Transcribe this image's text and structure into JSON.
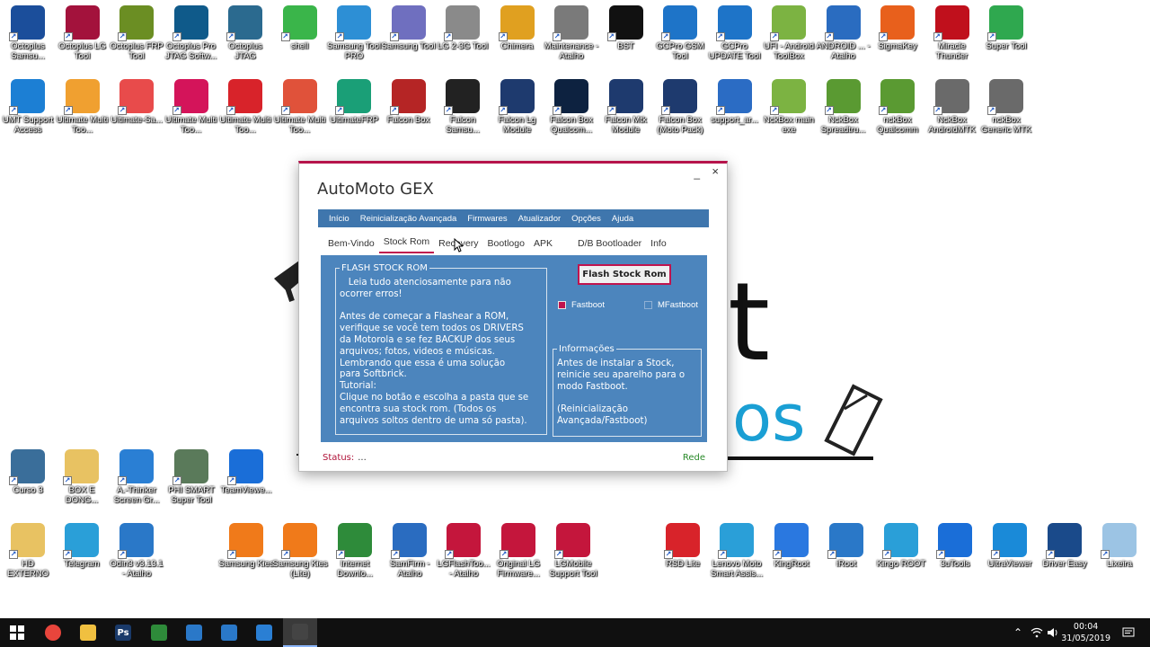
{
  "desktop": {
    "row1": [
      {
        "label": "Octoplus Samsu...",
        "icon": "octoplus-icon",
        "color": "#1b4e9b"
      },
      {
        "label": "Octoplus LG Tool",
        "icon": "octoplus-lg-icon",
        "color": "#a3123c"
      },
      {
        "label": "Octoplus FRP Tool",
        "icon": "octoplus-frp-icon",
        "color": "#6b8e23"
      },
      {
        "label": "Octoplus Pro JTAG Softw...",
        "icon": "octoplus-pro-icon",
        "color": "#0f5a8a"
      },
      {
        "label": "Octoplus JTAG",
        "icon": "octoplus-jtag-icon",
        "color": "#2b6a8f"
      },
      {
        "label": "shell",
        "icon": "shell-icon",
        "color": "#3ab54a"
      },
      {
        "label": "Samsung Tool PRO",
        "icon": "samsung-tool-pro-icon",
        "color": "#2d8fd5"
      },
      {
        "label": "Samsung Tool",
        "icon": "samsung-tool-icon",
        "color": "#6f6fbf"
      },
      {
        "label": "LG 2-3G Tool",
        "icon": "lg-tool-icon",
        "color": "#8a8a8a"
      },
      {
        "label": "Chimera",
        "icon": "chimera-icon",
        "color": "#e0a020"
      },
      {
        "label": "Maintenance - Atalho",
        "icon": "maintenance-icon",
        "color": "#7a7a7a"
      },
      {
        "label": "BST",
        "icon": "bst-icon",
        "color": "#111111"
      },
      {
        "label": "GCPro GSM Tool",
        "icon": "gcpro-gsm-icon",
        "color": "#1e74c8"
      },
      {
        "label": "GCPro UPDATE Tool",
        "icon": "gcpro-update-icon",
        "color": "#1e74c8"
      },
      {
        "label": "UFI - Android ToolBox",
        "icon": "ufi-android-icon",
        "color": "#7cb342"
      },
      {
        "label": "ANDROID ... - Atalho",
        "icon": "android-atalho-icon",
        "color": "#2a6cc0"
      },
      {
        "label": "SigmaKey",
        "icon": "sigmakey-icon",
        "color": "#e8601c"
      },
      {
        "label": "Miracle Thunder",
        "icon": "miracle-thunder-icon",
        "color": "#c0101c"
      },
      {
        "label": "Super Tool",
        "icon": "super-tool-icon",
        "color": "#2fa84f"
      }
    ],
    "row2": [
      {
        "label": "UMT Support Access",
        "icon": "umt-icon",
        "color": "#1c7fd4"
      },
      {
        "label": "Ultimate Multi Too...",
        "icon": "ultimate-multi-icon",
        "color": "#f0a030"
      },
      {
        "label": "Ultimate-Sa...",
        "icon": "ultimate-sa-icon",
        "color": "#e84b4b"
      },
      {
        "label": "Ultimate Multi Too...",
        "icon": "ultimate-multi-lg-icon",
        "color": "#d4145a"
      },
      {
        "label": "Ultimate Multi Too...",
        "icon": "ultimate-multi-sd-icon",
        "color": "#d8232a"
      },
      {
        "label": "Ultimate Multi Too...",
        "icon": "ultimate-multi-phone-icon",
        "color": "#e0523a"
      },
      {
        "label": "UltimateFRP",
        "icon": "ultimate-frp-icon",
        "color": "#1a9f77"
      },
      {
        "label": "Falcon Box",
        "icon": "falcon-box-icon",
        "color": "#b52525"
      },
      {
        "label": "Falcon Samsu...",
        "icon": "falcon-samsung-icon",
        "color": "#222222"
      },
      {
        "label": "Falcon Lg Module",
        "icon": "falcon-lg-icon",
        "color": "#1e3a6e"
      },
      {
        "label": "Falcon Box Qualcom...",
        "icon": "falcon-qualcomm-icon",
        "color": "#0d2240"
      },
      {
        "label": "Falcon Mtk Module",
        "icon": "falcon-mtk-icon",
        "color": "#1e3a6e"
      },
      {
        "label": "Falcon Box (Moto Pack)",
        "icon": "falcon-moto-icon",
        "color": "#1e3a6e"
      },
      {
        "label": "support_ar...",
        "icon": "support-icon",
        "color": "#2b6cc4"
      },
      {
        "label": "NckBox main exe",
        "icon": "nckbox-main-icon",
        "color": "#7cb342"
      },
      {
        "label": "NckBox Spreadtru...",
        "icon": "nckbox-spreadtrum-icon",
        "color": "#5a9a32"
      },
      {
        "label": "nckBox Qualcomm",
        "icon": "nckbox-qualcomm-icon",
        "color": "#5a9a32"
      },
      {
        "label": "NckBox AndroidMTK",
        "icon": "nckbox-androidmtk-icon",
        "color": "#6a6a6a"
      },
      {
        "label": "nckBox Generic MTK",
        "icon": "nckbox-generic-icon",
        "color": "#6a6a6a"
      }
    ],
    "row3": [
      {
        "label": "Curso 3",
        "icon": "curso-icon",
        "color": "#3a6e9a"
      },
      {
        "label": "BOX E DONG...",
        "icon": "folder-icon",
        "color": "#e8c262"
      },
      {
        "label": "A.-Thinker Screen Gr...",
        "icon": "screen-grabber-icon",
        "color": "#2a7fd4"
      },
      {
        "label": "PHI SMART Super Tool",
        "icon": "phi-smart-icon",
        "color": "#5a7a5a"
      },
      {
        "label": "TeamViewe...",
        "icon": "teamviewer-icon",
        "color": "#1a6ed8"
      }
    ],
    "row4": [
      {
        "label": "HD EXTERNO",
        "icon": "folder-icon",
        "color": "#e8c262"
      },
      {
        "label": "Telegram",
        "icon": "telegram-icon",
        "color": "#2a9fd8"
      },
      {
        "label": "Odin3 v3.13.1 - Atalho",
        "icon": "odin-icon",
        "color": "#2a78c8"
      },
      {
        "label": "Samsung Kies",
        "icon": "samsung-kies-icon",
        "color": "#f07a1a"
      },
      {
        "label": "Samsung Kies (Lite)",
        "icon": "samsung-kies-lite-icon",
        "color": "#f07a1a"
      },
      {
        "label": "Internet Downlo...",
        "icon": "idm-icon",
        "color": "#2e8b3a"
      },
      {
        "label": "SamFirm - Atalho",
        "icon": "samfirm-icon",
        "color": "#2a6cc0"
      },
      {
        "label": "LGFlashToo... - Atalho",
        "icon": "lg-flash-icon",
        "color": "#c4163c"
      },
      {
        "label": "Original LG Firmware...",
        "icon": "lg-firmware-icon",
        "color": "#c4163c"
      },
      {
        "label": "LGMobile Support Tool",
        "icon": "lg-mobile-icon",
        "color": "#c4163c"
      },
      {
        "label": "RSD Lite",
        "icon": "rsd-lite-icon",
        "color": "#d8232a"
      },
      {
        "label": "Lenovo Moto Smart Assis...",
        "icon": "lenovo-moto-icon",
        "color": "#2a9fd8"
      },
      {
        "label": "KingRoot",
        "icon": "kingroot-icon",
        "color": "#2a78e0"
      },
      {
        "label": "iRoot",
        "icon": "iroot-icon",
        "color": "#2a78c8"
      },
      {
        "label": "Kingo ROOT",
        "icon": "kingo-root-icon",
        "color": "#2a9fd8"
      },
      {
        "label": "3uTools",
        "icon": "3utools-icon",
        "color": "#1a6ed8"
      },
      {
        "label": "UltraViewer",
        "icon": "ultraviewer-icon",
        "color": "#1a8ad8"
      },
      {
        "label": "Driver Easy",
        "icon": "driver-easy-icon",
        "color": "#1a4a8a"
      },
      {
        "label": "Lixeira",
        "icon": "recycle-bin-icon",
        "color": "#9cc4e4"
      }
    ]
  },
  "window": {
    "title": "AutoMoto GEX",
    "minimize_glyph": "_",
    "close_glyph": "×",
    "menu": [
      "Início",
      "Reinicialização Avançada",
      "Firmwares",
      "Atualizador",
      "Opções",
      "Ajuda"
    ],
    "tabs": [
      "Bem-Vindo",
      "Stock Rom",
      "Recovery",
      "Bootlogo",
      "APK",
      "D/B Bootloader",
      "Info"
    ],
    "active_tab": "Stock Rom",
    "flash_group": {
      "legend": "FLASH STOCK ROM",
      "text": "   Leia tudo atenciosamente para não\nocorrer erros!\n\nAntes de começar a Flashear a ROM,\nverifique se você tem todos os DRIVERS\nda Motorola e se fez BACKUP dos seus\narquivos; fotos, videos e músicas.\nLembrando que essa é uma solução\npara Softbrick.\nTutorial:\nClique no botão e escolha a pasta que se\nencontra sua stock rom. (Todos os\narquivos soltos dentro de uma só pasta)."
    },
    "flash_button": "Flash Stock Rom",
    "checkbox_fastboot": "Fastboot",
    "checkbox_mfastboot": "MFastboot",
    "info_group": {
      "legend": "Informações",
      "text": "Antes de instalar a Stock,\nreinicie seu aparelho para o\nmodo Fastboot.\n\n(Reinicialização\nAvançada/Fastboot)"
    },
    "status_label": "Status:",
    "status_value": "...",
    "network_label": "Rede"
  },
  "taskbar": {
    "clock_time": "00:04",
    "clock_date": "31/05/2019",
    "apps": [
      {
        "name": "windows-start-icon"
      },
      {
        "name": "chrome-icon",
        "color": "#e8453c"
      },
      {
        "name": "file-explorer-icon",
        "color": "#f0c040"
      },
      {
        "name": "photoshop-icon",
        "color": "#1a3a6a",
        "text": "Ps"
      },
      {
        "name": "xbox-icon",
        "color": "#2e8b3a"
      },
      {
        "name": "vpn-shield-icon",
        "color": "#2a78c8"
      },
      {
        "name": "tool-icon",
        "color": "#2a78c8"
      },
      {
        "name": "screen-grabber-icon",
        "color": "#2a7fd4"
      },
      {
        "name": "automoto-icon",
        "color": "#444444"
      }
    ]
  },
  "colors": {
    "accent": "#b6144b",
    "panel_blue": "#4c85bd",
    "menu_blue": "#3f76ad"
  }
}
